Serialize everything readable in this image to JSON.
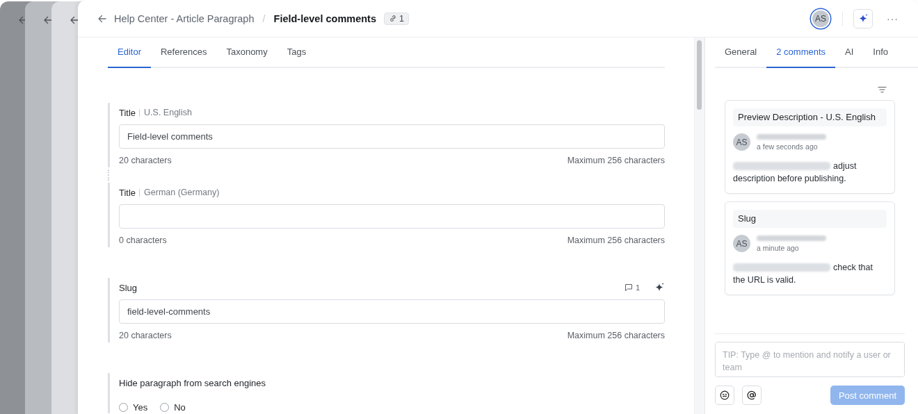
{
  "header": {
    "breadcrumb": "Help Center - Article Paragraph",
    "separator": "/",
    "more": "···",
    "title": "Field-level comments",
    "link_count": "1",
    "avatar": "AS"
  },
  "editor_tabs": [
    {
      "label": "Editor",
      "selected": true
    },
    {
      "label": "References",
      "selected": false
    },
    {
      "label": "Taxonomy",
      "selected": false
    },
    {
      "label": "Tags",
      "selected": false
    }
  ],
  "sections": [
    {
      "fields": [
        {
          "kind": "text",
          "label": "Title",
          "locale": "U.S. English",
          "value": "Field-level comments",
          "count": "20 characters",
          "max": "Maximum 256 characters"
        },
        {
          "kind": "text",
          "label": "Title",
          "locale": "German (Germany)",
          "count": "0 characters",
          "max": "Maximum 256 characters"
        }
      ]
    },
    {
      "fields": [
        {
          "kind": "text",
          "label": "Slug",
          "comment_count": "1",
          "ai": true,
          "value": "field-level-comments",
          "count": "20 characters",
          "max": "Maximum 256 characters"
        }
      ]
    },
    {
      "fields": [
        {
          "kind": "radio",
          "label": "Hide paragraph from search engines",
          "options": [
            {
              "label": "Yes",
              "selected": false
            },
            {
              "label": "No",
              "selected": false
            }
          ]
        }
      ]
    }
  ],
  "panel_tabs": [
    {
      "label": "General",
      "selected": false
    },
    {
      "label": "2 comments",
      "selected": true
    },
    {
      "label": "AI",
      "selected": false
    },
    {
      "label": "Info",
      "selected": false
    }
  ],
  "comments": [
    {
      "field": "Preview Description - U.S. English",
      "avatar": "AS",
      "time": "a few seconds ago",
      "text_lines": [
        "adjust",
        "description before publishing."
      ]
    },
    {
      "field": "Slug",
      "avatar": "AS",
      "time": "a minute ago",
      "text_lines": [
        "check that",
        "the URL is valid."
      ]
    }
  ],
  "composer": {
    "placeholder": "TIP: Type @ to mention and notify a user or team",
    "post_button": "Post comment",
    "post_disabled": true
  }
}
